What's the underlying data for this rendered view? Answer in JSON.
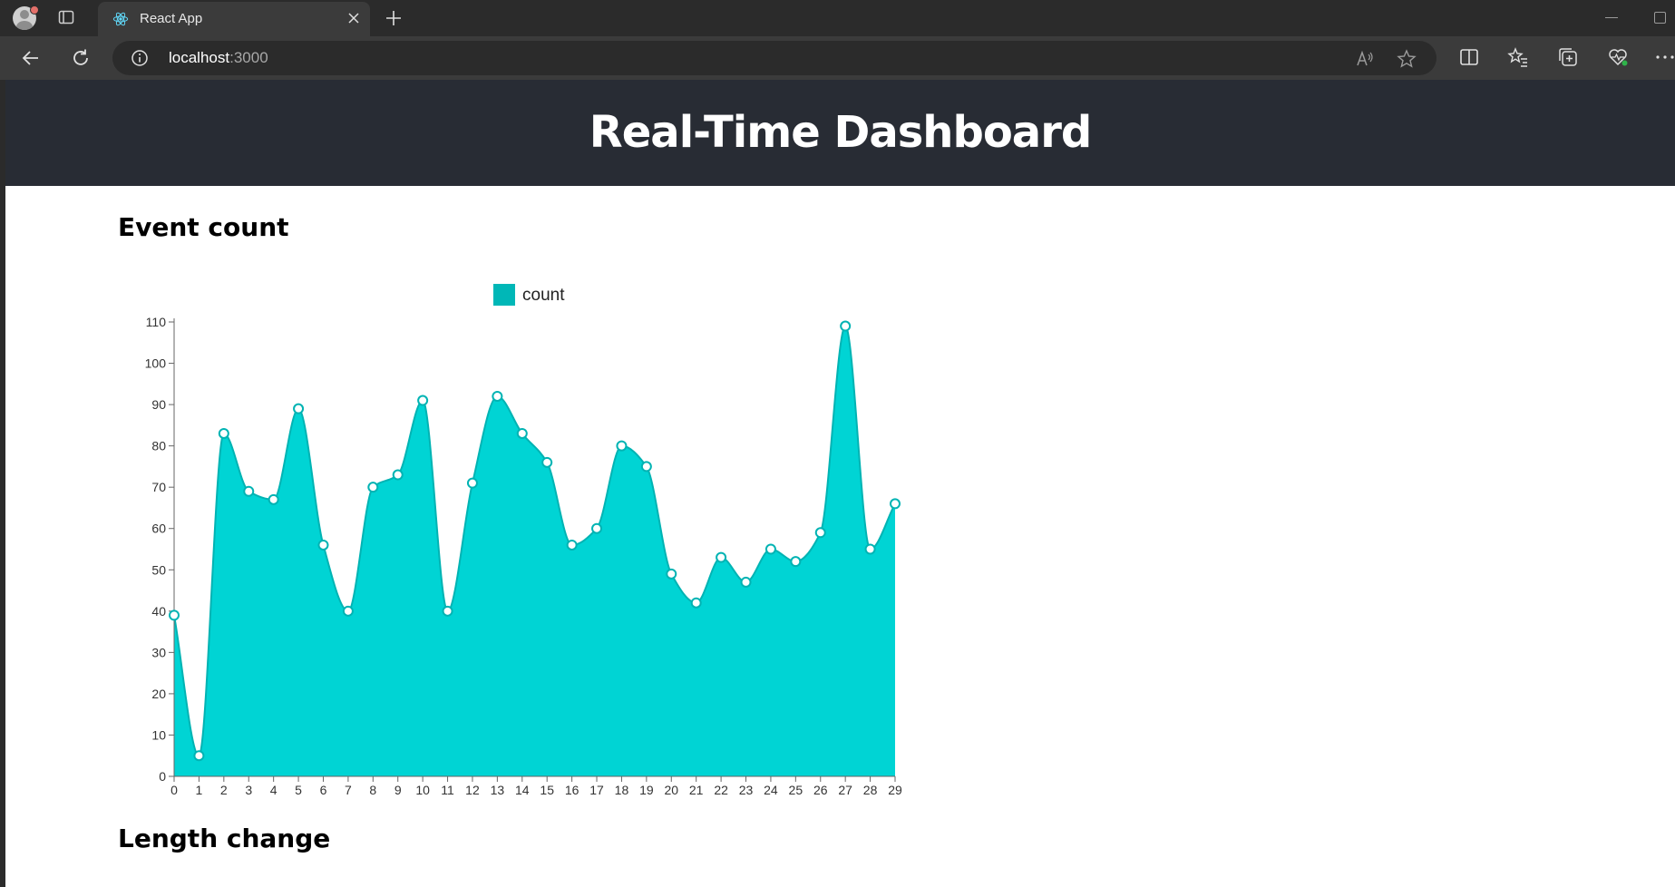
{
  "browser": {
    "tab_title": "React App",
    "url_host": "localhost",
    "url_port": ":3000"
  },
  "page": {
    "title": "Real-Time Dashboard",
    "sections": [
      "Event count",
      "Length change"
    ]
  },
  "colors": {
    "header_bg": "#282c34",
    "area_fill": "#00d4d4",
    "area_stroke": "#00b3b3",
    "legend_swatch": "#00b7b7"
  },
  "chart_data": {
    "type": "area",
    "title": "",
    "xlabel": "",
    "ylabel": "",
    "x": [
      0,
      1,
      2,
      3,
      4,
      5,
      6,
      7,
      8,
      9,
      10,
      11,
      12,
      13,
      14,
      15,
      16,
      17,
      18,
      19,
      20,
      21,
      22,
      23,
      24,
      25,
      26,
      27,
      28,
      29
    ],
    "series": [
      {
        "name": "count",
        "values": [
          39,
          5,
          83,
          69,
          67,
          89,
          56,
          40,
          70,
          73,
          91,
          40,
          71,
          92,
          83,
          76,
          56,
          60,
          80,
          75,
          49,
          42,
          53,
          47,
          55,
          52,
          59,
          109,
          55,
          66
        ]
      }
    ],
    "ylim": [
      0,
      110
    ],
    "yticks": [
      0,
      10,
      20,
      30,
      40,
      50,
      60,
      70,
      80,
      90,
      100,
      110
    ],
    "xticks": [
      0,
      1,
      2,
      3,
      4,
      5,
      6,
      7,
      8,
      9,
      10,
      11,
      12,
      13,
      14,
      15,
      16,
      17,
      18,
      19,
      20,
      21,
      22,
      23,
      24,
      25,
      26,
      27,
      28,
      29
    ],
    "legend": "top",
    "grid": false,
    "smooth": true,
    "markers": true
  }
}
